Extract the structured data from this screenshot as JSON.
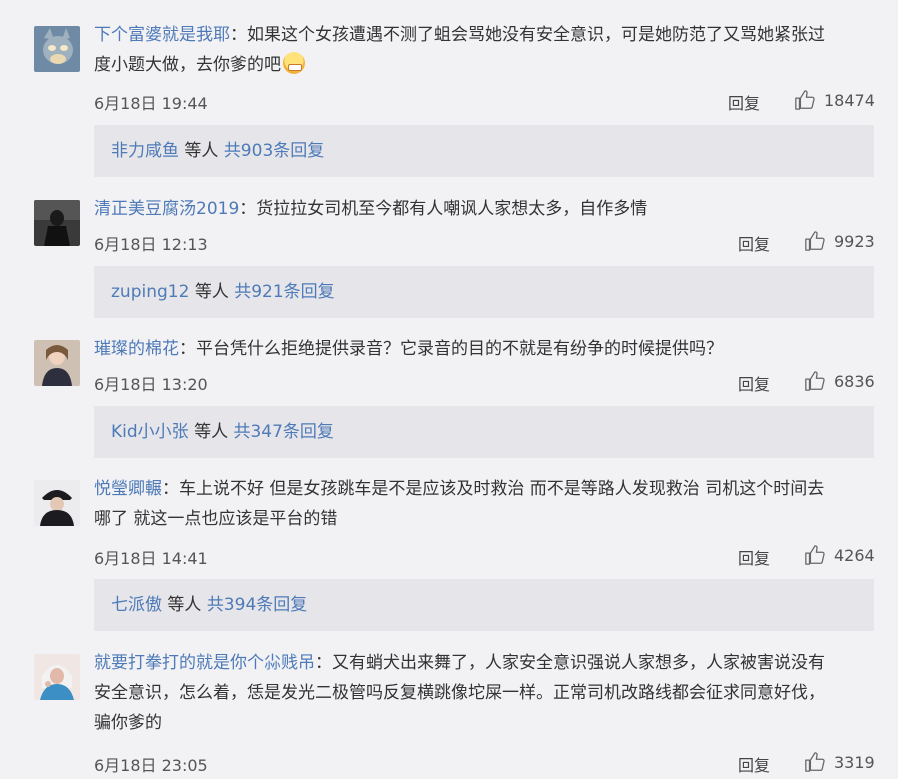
{
  "comments": [
    {
      "user": "下个富婆就是我耶",
      "text_lines": [
        "如果这个女孩遭遇不测了蛆会骂她没有安全意识，可是她防范了又骂她紧张过",
        "度小题大做，去你爹的吧"
      ],
      "has_emoji": true,
      "emoji_icon": "laughing-tears-emoji",
      "time": "6月18日 19:44",
      "reply": "回复",
      "likes": "18474",
      "sub_user": "非力咸鱼",
      "sub_mid": " 等人 ",
      "sub_total": "共903条回复",
      "avatar_colors": [
        "#5a7c9a",
        "#c9b28a"
      ]
    },
    {
      "user": "清正美豆腐汤2019",
      "text_lines": [
        "货拉拉女司机至今都有人嘲讽人家想太多，自作多情"
      ],
      "time": "6月18日 12:13",
      "reply": "回复",
      "likes": "9923",
      "sub_user": "zuping12",
      "sub_mid": " 等人 ",
      "sub_total": "共921条回复",
      "avatar_colors": [
        "#2a2a2a",
        "#6a6a6a"
      ]
    },
    {
      "user": "璀璨的棉花",
      "text_lines": [
        "平台凭什么拒绝提供录音？它录音的目的不就是有纷争的时候提供吗？"
      ],
      "time": "6月18日 13:20",
      "reply": "回复",
      "likes": "6836",
      "sub_user": "Kid小小张",
      "sub_mid": " 等人 ",
      "sub_total": "共347条回复",
      "avatar_colors": [
        "#d9c3b0",
        "#3a3a4a"
      ]
    },
    {
      "user": "悦瑩卿輾",
      "text_lines": [
        "车上说不好 但是女孩跳车是不是应该及时救治 而不是等路人发现救治 司机这个时间去",
        "哪了 就这一点也应该是平台的错"
      ],
      "time": "6月18日 14:41",
      "reply": "回复",
      "likes": "4264",
      "sub_user": "七派傲",
      "sub_mid": " 等人 ",
      "sub_total": "共394条回复",
      "avatar_colors": [
        "#e8e8ea",
        "#1e1e22"
      ]
    },
    {
      "user": "就要打拳打的就是你个尛贱吊",
      "text_lines": [
        "又有蛸犬出来舞了，人家安全意识强说人家想多，人家被害说没有",
        "安全意识，怎么着，恁是发光二极管吗反复横跳像坨屎一样。正常司机改路线都会征求同意好伐，",
        "骗你爹的"
      ],
      "time": "6月18日 23:05",
      "reply": "回复",
      "likes": "3319",
      "avatar_colors": [
        "#e6c7c0",
        "#3b8fc4"
      ]
    }
  ],
  "colors": {
    "link": "#4e7ab8",
    "background": "#f2f2f5",
    "sub_background": "#e6e6ea"
  },
  "icons": {
    "like": "thumbs-up-icon"
  }
}
